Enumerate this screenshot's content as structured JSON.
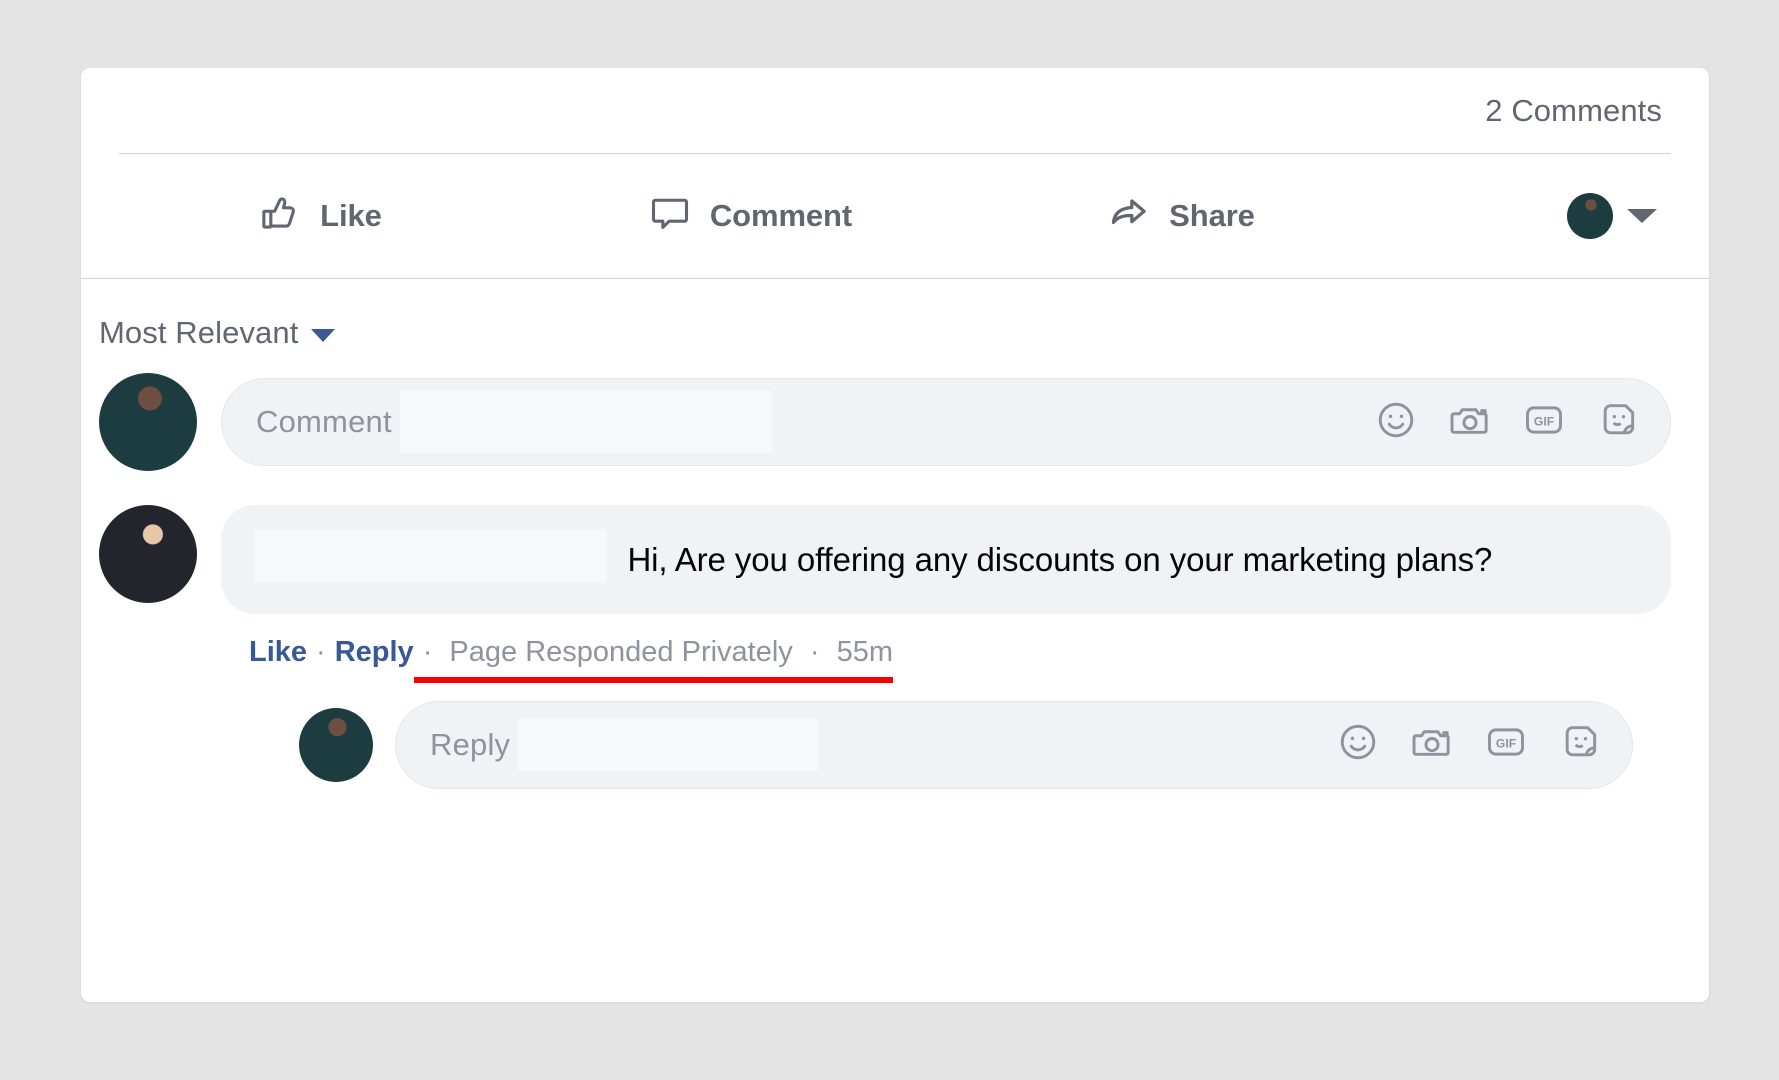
{
  "theme": {
    "page_bg": "#e4e4e4",
    "card_bg": "#ffffff",
    "text_primary": "#050505",
    "text_secondary": "#606770",
    "text_muted": "#8d949e",
    "link_blue": "#385898",
    "accent_red": "#f60000",
    "field_bg": "#f0f2f5",
    "divider": "#ced0d4"
  },
  "post": {
    "comment_count_label": "2 Comments"
  },
  "actions": [
    {
      "label": "Like",
      "icon": "thumbs-up-icon"
    },
    {
      "label": "Comment",
      "icon": "comment-bubble-icon"
    },
    {
      "label": "Share",
      "icon": "share-arrow-icon"
    }
  ],
  "viewer": {
    "avatar_icon": "viewer-avatar",
    "caret_icon": "chevron-down-icon"
  },
  "comments_section": {
    "sort": {
      "label": "Most Relevant",
      "caret_icon": "caret-down-icon"
    },
    "composer": {
      "avatar_icon": "current-user-avatar",
      "placeholder": "Comment",
      "redacted": true,
      "tools": [
        {
          "name": "emoji-icon",
          "label": "Emoji"
        },
        {
          "name": "camera-icon",
          "label": "Camera"
        },
        {
          "name": "gif-icon",
          "label": "GIF"
        },
        {
          "name": "sticker-icon",
          "label": "Sticker"
        }
      ]
    },
    "comments": [
      {
        "avatar_icon": "commenter-avatar",
        "author_redacted": true,
        "text": "Hi, Are you offering any discounts on your marketing plans?",
        "meta": {
          "like_label": "Like",
          "reply_label": "Reply",
          "status_label": "Page Responded Privately",
          "timestamp": "55m",
          "separator": "·",
          "status_underlined": true
        },
        "reply_box": {
          "avatar_icon": "current-user-avatar",
          "placeholder": "Reply",
          "redacted": true,
          "tools": [
            {
              "name": "emoji-icon",
              "label": "Emoji"
            },
            {
              "name": "camera-icon",
              "label": "Camera"
            },
            {
              "name": "gif-icon",
              "label": "GIF"
            },
            {
              "name": "sticker-icon",
              "label": "Sticker"
            }
          ]
        }
      }
    ]
  }
}
